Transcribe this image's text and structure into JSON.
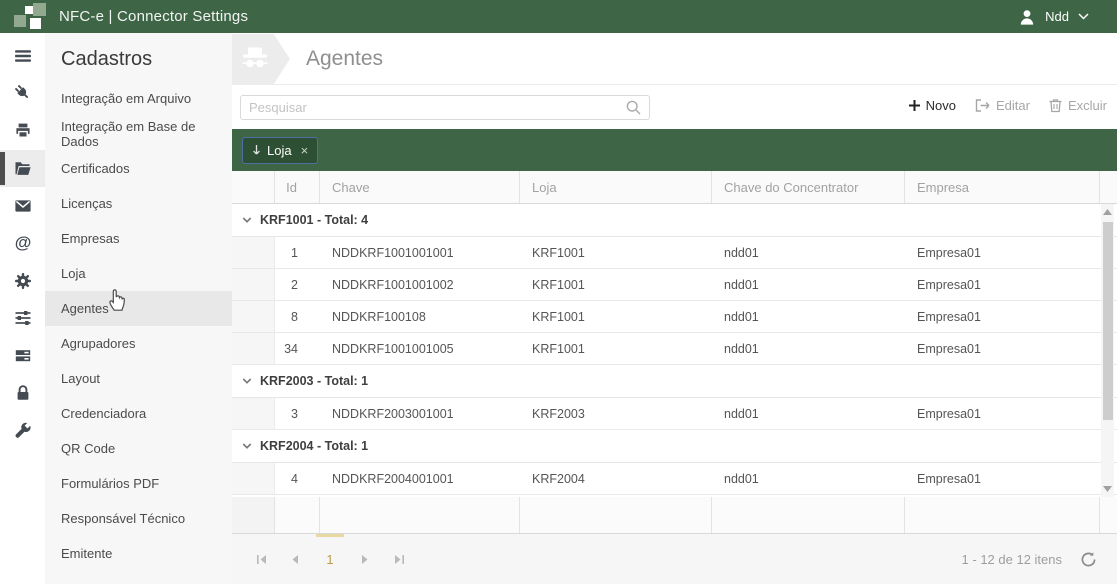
{
  "topbar": {
    "title": "NFC-e | Connector Settings",
    "user_name": "Ndd"
  },
  "rail": {
    "icons": [
      "hamburger-icon",
      "plug-icon",
      "printer-icon",
      "folder-open-icon",
      "envelope-icon",
      "at-sign-icon",
      "gear-icon",
      "sliders-icon",
      "server-icon",
      "lock-icon",
      "wrench-icon"
    ],
    "active_icon": "folder-open-icon"
  },
  "sidebar": {
    "heading": "Cadastros",
    "items": [
      "Integração em Arquivo",
      "Integração em Base de Dados",
      "Certificados",
      "Licenças",
      "Empresas",
      "Loja",
      "Agentes",
      "Agrupadores",
      "Layout",
      "Credenciadora",
      "QR Code",
      "Formulários PDF",
      "Responsável Técnico",
      "Emitente"
    ],
    "active": "Agentes"
  },
  "page": {
    "title": "Agentes",
    "title_icon": "spy-agent-icon"
  },
  "toolbar": {
    "search_placeholder": "Pesquisar",
    "new_label": "Novo",
    "edit_label": "Editar",
    "delete_label": "Excluir"
  },
  "grid": {
    "group_chip_label": "Loja",
    "columns": [
      "Id",
      "Chave",
      "Loja",
      "Chave do Concentrator",
      "Empresa"
    ],
    "groups": [
      {
        "label": "KRF1001 - Total: 4",
        "rows": [
          [
            "1",
            "NDDKRF1001001001",
            "KRF1001",
            "ndd01",
            "Empresa01"
          ],
          [
            "2",
            "NDDKRF1001001002",
            "KRF1001",
            "ndd01",
            "Empresa01"
          ],
          [
            "8",
            "NDDKRF100108",
            "KRF1001",
            "ndd01",
            "Empresa01"
          ],
          [
            "34",
            "NDDKRF1001001005",
            "KRF1001",
            "ndd01",
            "Empresa01"
          ]
        ]
      },
      {
        "label": "KRF2003 - Total: 1",
        "rows": [
          [
            "3",
            "NDDKRF2003001001",
            "KRF2003",
            "ndd01",
            "Empresa01"
          ]
        ]
      },
      {
        "label": "KRF2004 - Total: 1",
        "rows": [
          [
            "4",
            "NDDKRF2004001001",
            "KRF2004",
            "ndd01",
            "Empresa01"
          ]
        ]
      }
    ]
  },
  "pager": {
    "current_page": "1",
    "info": "1 - 12 de 12 itens"
  },
  "colors": {
    "header_green": "#3E6646",
    "chip_green": "#2D4F33",
    "chip_border_blue": "#4E6FA3",
    "page_accent_amber": "#BD9C49",
    "icon_gray": "#454B52"
  }
}
